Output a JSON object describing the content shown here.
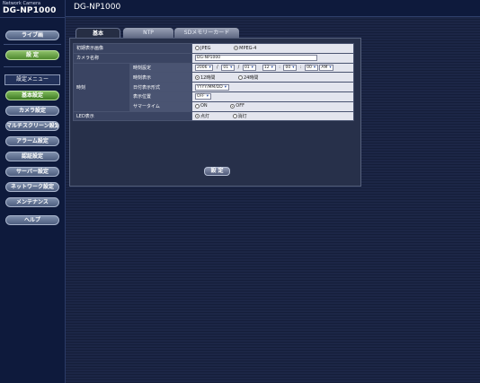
{
  "brand": {
    "small": "Network Camera",
    "model": "DG-NP1000"
  },
  "header": {
    "title": "DG-NP1000"
  },
  "sidebar": {
    "live_label": "ライブ画",
    "setup_label": "設 定",
    "menu_heading": "設定メニュー",
    "items": [
      {
        "label": "基本設定"
      },
      {
        "label": "カメラ設定"
      },
      {
        "label": "マルチスクリーン設定"
      },
      {
        "label": "アラーム設定"
      },
      {
        "label": "認証設定"
      },
      {
        "label": "サーバー設定"
      },
      {
        "label": "ネットワーク設定"
      },
      {
        "label": "メンテナンス"
      },
      {
        "label": "ヘルプ"
      }
    ]
  },
  "tabs": [
    {
      "label": "基本"
    },
    {
      "label": "NTP"
    },
    {
      "label": "SDメモリーカード"
    }
  ],
  "form": {
    "initial_image": {
      "label": "初期表示画像",
      "options": [
        "JPEG",
        "MPEG-4"
      ],
      "selected": "MPEG-4"
    },
    "camera_name": {
      "label": "カメラ名称",
      "value": "DG-NP1000"
    },
    "clock": {
      "label": "時刻",
      "time_setting": {
        "label": "時刻設定",
        "year": "2006",
        "month": "01",
        "day": "01",
        "hour": "12",
        "minute": "00",
        "second": "00",
        "ampm": "AM",
        "sep_slash": "/",
        "sep_colon": ":"
      },
      "time_display": {
        "label": "時刻表示",
        "options": [
          "12時間",
          "24時間"
        ],
        "selected": "12時間"
      },
      "date_format": {
        "label": "日付表示形式",
        "value": "YYYY/MM/DD"
      },
      "display_position": {
        "label": "表示位置",
        "value": "OFF"
      },
      "summer_time": {
        "label": "サマータイム",
        "options": [
          "ON",
          "OFF"
        ],
        "selected": "OFF"
      }
    },
    "led": {
      "label": "LED表示",
      "options": [
        "点灯",
        "消灯"
      ],
      "selected": "点灯"
    },
    "set_button_label": "設 定"
  },
  "colors": {
    "background": "#141e38",
    "sidebar": "#0e1a3c",
    "green_button": "#5a9838",
    "panel": "#27304a"
  }
}
